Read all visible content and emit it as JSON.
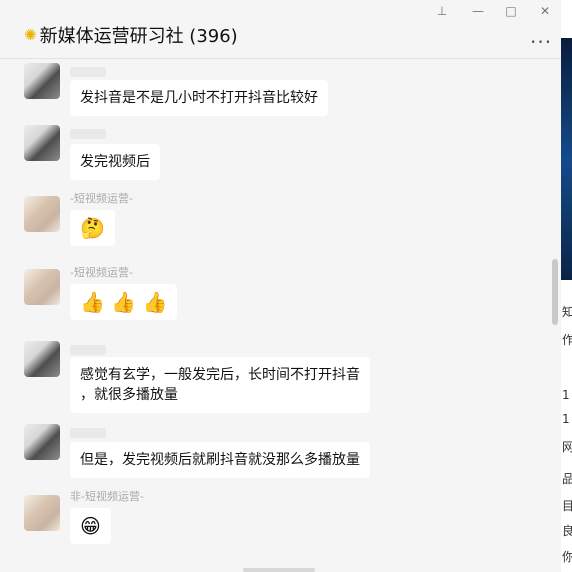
{
  "window": {
    "title": "新媒体运营研习社 (396)",
    "controls": {
      "pin": "⊥",
      "minimize": "—",
      "maximize": "□",
      "close": "✕"
    },
    "more": "···"
  },
  "messages": [
    {
      "avatar": "dark",
      "name": "",
      "text": "发抖音是不是几小时不打开抖音比较好"
    },
    {
      "avatar": "dark",
      "name": "",
      "text": "发完视频后"
    },
    {
      "avatar": "light",
      "name": "-短视频运营-",
      "emoji": "🤔"
    },
    {
      "avatar": "light",
      "name": "-短视频运营-",
      "emoji": "👍 👍 👍"
    },
    {
      "avatar": "dark",
      "name": "",
      "text_line1": "感觉有玄学，一般发完后，长时间不打开抖音",
      "text_line2": "，就很多播放量"
    },
    {
      "avatar": "dark",
      "name": "",
      "text": "但是，发完视频后就刷抖音就没那么多播放量"
    },
    {
      "avatar": "light",
      "name": "非-短视频运营-",
      "emoji": "😁"
    }
  ],
  "right_panel": {
    "fragments": [
      "知",
      "作",
      "1",
      "1",
      "网",
      "品",
      "目",
      "良",
      "你"
    ]
  },
  "colors": {
    "accent": "#e9b400",
    "chat_bg": "#f5f5f5",
    "bubble_bg": "#ffffff"
  }
}
